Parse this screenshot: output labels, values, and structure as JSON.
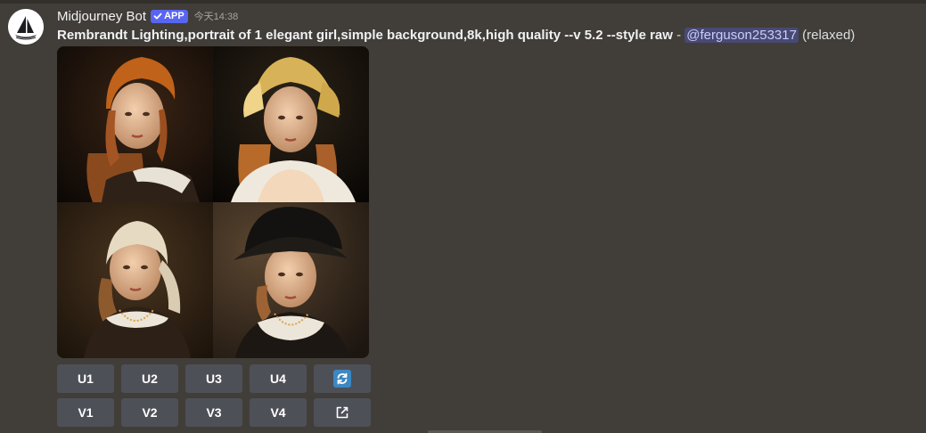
{
  "message": {
    "author": "Midjourney Bot",
    "badge": {
      "label": "APP",
      "icon": "checkmark-icon",
      "color": "#5865f2"
    },
    "timestamp": "今天14:38",
    "prompt": "Rembrandt Lighting,portrait of 1 elegant girl,simple background,8k,high quality --v 5.2 --style raw",
    "separator": " - ",
    "mention": "@ferguson253317",
    "mode": "(relaxed)",
    "avatar_icon": "midjourney-sailboat-icon"
  },
  "image": {
    "description_icon": "portrait-grid-image",
    "tiles": [
      "portrait-1-orange-headscarf",
      "portrait-2-golden-veil",
      "portrait-3-cream-headscarf",
      "portrait-4-black-hat"
    ]
  },
  "buttons": {
    "upscale": [
      "U1",
      "U2",
      "U3",
      "U4"
    ],
    "variation": [
      "V1",
      "V2",
      "V3",
      "V4"
    ],
    "reroll_icon": "reroll-icon",
    "open_icon": "external-link-icon"
  },
  "colors": {
    "background": "#413d38",
    "button": "#4e5058",
    "brand": "#5865f2",
    "mention_text": "#c9cdfb"
  }
}
